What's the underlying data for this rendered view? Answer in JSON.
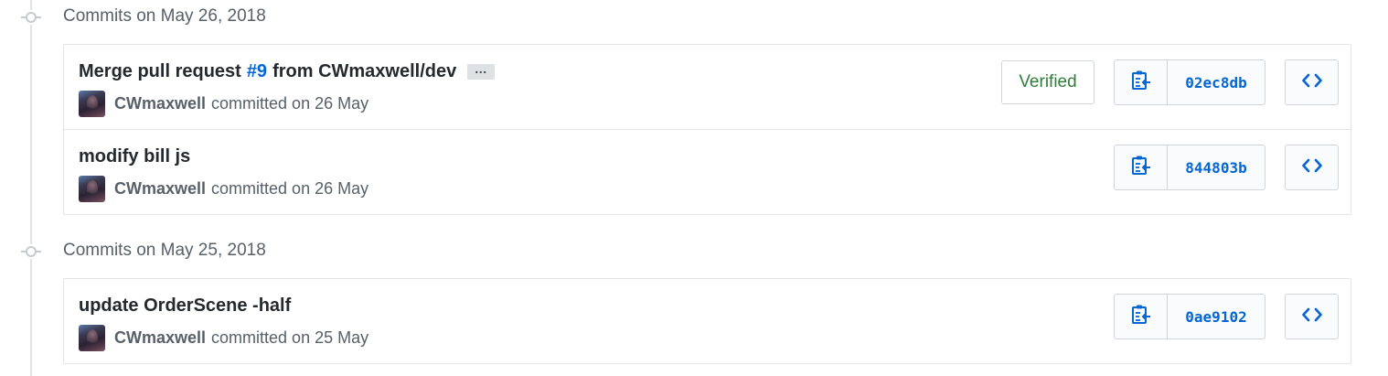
{
  "groups": [
    {
      "title": "Commits on May 26, 2018",
      "commits": [
        {
          "title_prefix": "Merge pull request",
          "issue": "#9",
          "title_suffix": "from CWmaxwell/dev",
          "has_more": true,
          "more_label": "…",
          "author": "CWmaxwell",
          "meta": "committed on 26 May",
          "verified": "Verified",
          "sha": "02ec8db"
        },
        {
          "title": "modify bill js",
          "author": "CWmaxwell",
          "meta": "committed on 26 May",
          "sha": "844803b"
        }
      ]
    },
    {
      "title": "Commits on May 25, 2018",
      "commits": [
        {
          "title": "update OrderScene -half",
          "author": "CWmaxwell",
          "meta": "committed on 25 May",
          "sha": "0ae9102"
        }
      ]
    }
  ],
  "icons": {
    "copy": "clipboard-icon",
    "browse": "code-icon",
    "timeline": "git-commit-icon"
  },
  "colors": {
    "link": "#0366d6",
    "verified": "#2f7d3a",
    "muted": "#586069",
    "border": "#e1e4e8"
  }
}
